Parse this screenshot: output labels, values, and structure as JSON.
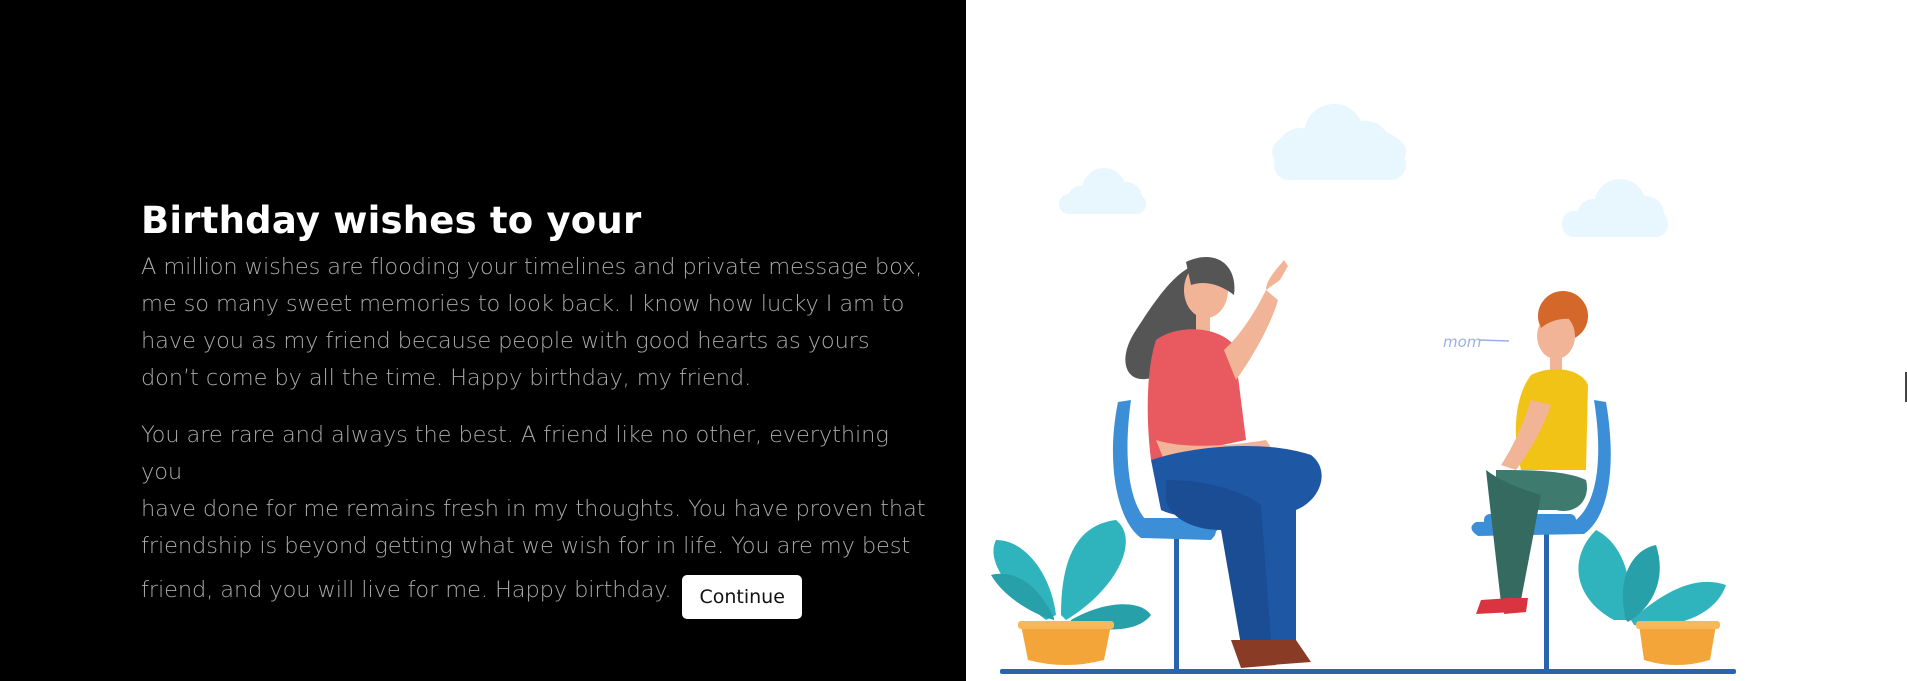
{
  "main": {
    "heading": "Birthday wishes to your",
    "paragraph_1": "A million wishes are flooding your timelines and private message box, me so many sweet memories to look back. I know how lucky I am to have you as my friend because people with good hearts as yours don’t come by all the time. Happy birthday, my friend.",
    "paragraph_2_lines": [
      "You are rare and always the best. A friend like no other, everything you",
      "have done for me remains fresh in my thoughts. You have proven that",
      "friendship is beyond getting what we wish for in life. You are my best"
    ],
    "paragraph_2_last": "friend, and you will live for me. Happy birthday.",
    "continue_label": "Continue"
  },
  "illustration": {
    "speech_text": "mom",
    "icons": [
      "cloud",
      "woman-in-chair",
      "boy-in-chair",
      "potted-plant"
    ],
    "colors": {
      "cloud": "#e8f6fd",
      "chair": "#3c8fd6",
      "woman_shirt": "#e85a5f",
      "woman_pants": "#1e57a4",
      "woman_hair": "#555555",
      "skin": "#f2b497",
      "boy_shirt": "#f2c317",
      "boy_pants": "#3f7a6f",
      "boy_hair": "#d4682b",
      "shoes": "#d9343f",
      "plant_leaf": "#2fb3bd",
      "pot": "#f3a53a",
      "floor": "#2a64ad"
    }
  }
}
